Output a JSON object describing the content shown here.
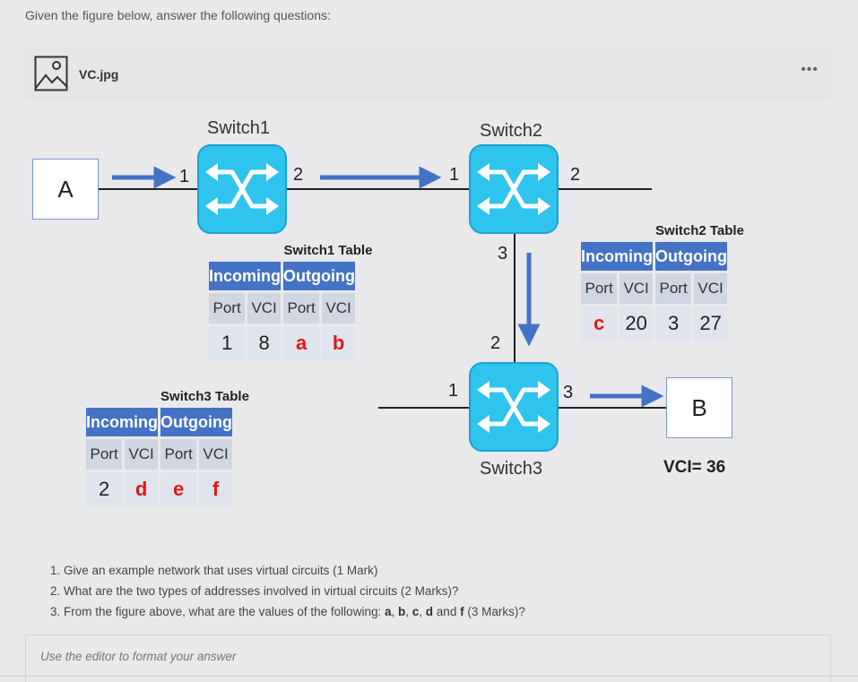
{
  "prompt": "Given the figure below, answer the following questions:",
  "attachment": {
    "filename": "VC.jpg",
    "icon": "image-icon",
    "menu": "•••"
  },
  "figure": {
    "hosts": {
      "source": "A",
      "destination": "B"
    },
    "destination_vci": "VCI= 36",
    "switches": [
      {
        "name": "Switch1",
        "ports": [
          "1",
          "2"
        ]
      },
      {
        "name": "Switch2",
        "ports": [
          "1",
          "2",
          "3"
        ]
      },
      {
        "name": "Switch3",
        "ports": [
          "2",
          "1",
          "3"
        ]
      }
    ],
    "tables": [
      {
        "title": "Switch1 Table",
        "groups": [
          "Incoming",
          "Outgoing"
        ],
        "columns": [
          "Port",
          "VCI",
          "Port",
          "VCI"
        ],
        "row": [
          "1",
          "8",
          "a",
          "b"
        ]
      },
      {
        "title": "Switch2 Table",
        "groups": [
          "Incoming",
          "Outgoing"
        ],
        "columns": [
          "Port",
          "VCI",
          "Port",
          "VCI"
        ],
        "row": [
          "c",
          "20",
          "3",
          "27"
        ]
      },
      {
        "title": "Switch3 Table",
        "groups": [
          "Incoming",
          "Outgoing"
        ],
        "columns": [
          "Port",
          "VCI",
          "Port",
          "VCI"
        ],
        "row": [
          "2",
          "d",
          "e",
          "f"
        ]
      }
    ],
    "colors": {
      "switch": "#2ec4ee",
      "arrow": "#4472c4",
      "header": "#4472c4",
      "unknown": "#e01818"
    }
  },
  "questions": [
    {
      "prefix": "1. Give an example network that uses virtual circuits (1 Mark)"
    },
    {
      "prefix": "2. What are the two types of addresses involved in virtual circuits (2 Marks)?"
    },
    {
      "prefix": "3. From the figure above, what are the values of the following: ",
      "vars": [
        "a",
        "b",
        "c",
        "d",
        "f"
      ],
      "sep": ", ",
      "and": " and ",
      "suffix": " (3 Marks)?"
    }
  ],
  "editor": {
    "placeholder": "Use the editor to format your answer"
  }
}
